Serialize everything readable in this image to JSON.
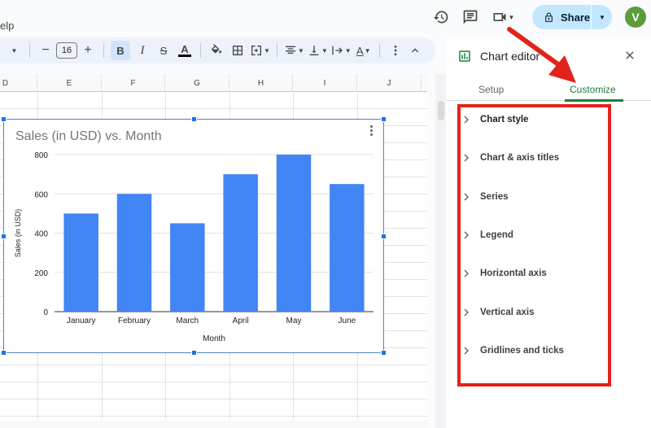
{
  "menu": {
    "fragment": "elp"
  },
  "header": {
    "share_label": "Share",
    "avatar_initial": "V",
    "icons": [
      "history-icon",
      "comment-icon",
      "meet-icon",
      "lock-icon"
    ]
  },
  "toolbar": {
    "font_size": "16",
    "bold_label": "B",
    "italic_label": "I",
    "strike_label": "S",
    "textcolor_label": "A",
    "textcolor2_label": "A",
    "minus_label": "−",
    "plus_label": "+"
  },
  "sheet": {
    "columns": [
      "D",
      "E",
      "F",
      "G",
      "H",
      "I",
      "J"
    ]
  },
  "chart_data": {
    "type": "bar",
    "title": "Sales (in USD) vs. Month",
    "xlabel": "Month",
    "ylabel": "Sales (in USD)",
    "categories": [
      "January",
      "February",
      "March",
      "April",
      "May",
      "June"
    ],
    "values": [
      500,
      600,
      450,
      700,
      800,
      650
    ],
    "ylim": [
      0,
      800
    ],
    "yticks": [
      0,
      200,
      400,
      600,
      800
    ],
    "bar_color": "#4285f4",
    "grid": true
  },
  "editor": {
    "title": "Chart editor",
    "tabs": [
      {
        "label": "Setup",
        "active": false
      },
      {
        "label": "Customize",
        "active": true
      }
    ],
    "sections": [
      "Chart style",
      "Chart & axis titles",
      "Series",
      "Legend",
      "Horizontal axis",
      "Vertical axis",
      "Gridlines and ticks"
    ]
  },
  "colors": {
    "accent_green": "#188038",
    "annotation_red": "#e2231a",
    "share_bg": "#c2e7ff",
    "avatar_bg": "#5c9c3a"
  }
}
